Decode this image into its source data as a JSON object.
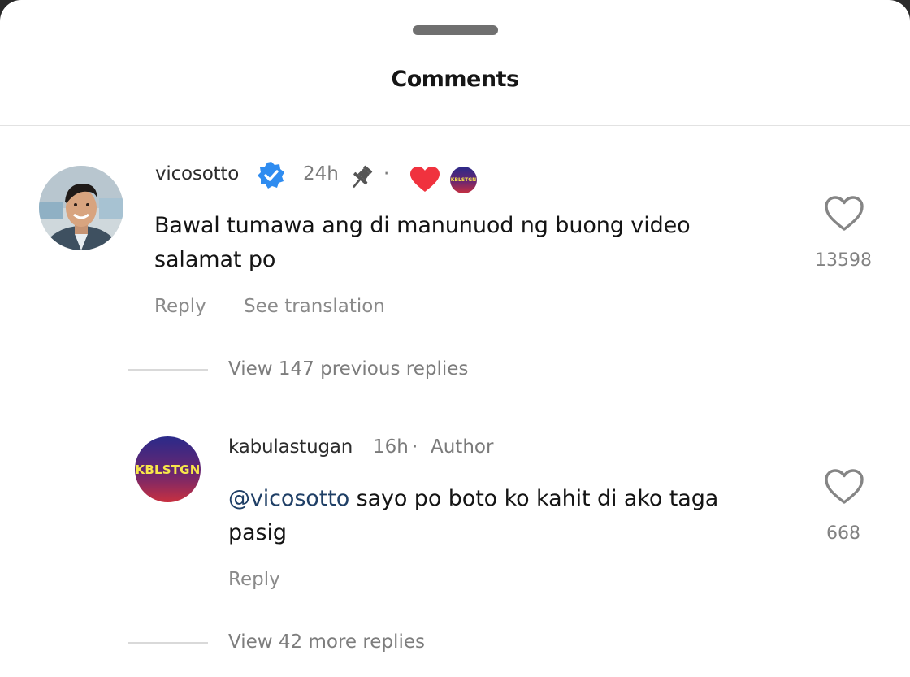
{
  "header": {
    "title": "Comments"
  },
  "comments": [
    {
      "username": "vicosotto",
      "time": "24h",
      "dot": "·",
      "text_line1": "Bawal tumawa ang di manunuod ng buong video",
      "text_line2": "salamat po",
      "reply_label": "Reply",
      "translate_label": "See translation",
      "like_count": "13598",
      "verified": true,
      "pinned": true,
      "liked_by_creator": true,
      "creator_badge_text": "KBLSTGN",
      "view_replies_label": "View 147 previous replies"
    },
    {
      "username": "kabulastugan",
      "time": "16h",
      "dot": "·",
      "author_tag": "Author",
      "avatar_text": "KBLSTGN",
      "mention": "@vicosotto",
      "text_line1_rest": " sayo po boto ko kahit di ako taga",
      "text_line2": "pasig",
      "reply_label": "Reply",
      "like_count": "668",
      "view_more_label": "View 42 more replies"
    }
  ],
  "colors": {
    "verified": "#2f8cf0",
    "heart_red": "#f0323e",
    "mention": "#1f3f66"
  },
  "icons": [
    "verified-badge-icon",
    "pin-icon",
    "heart-icon",
    "like-heart-icon"
  ]
}
